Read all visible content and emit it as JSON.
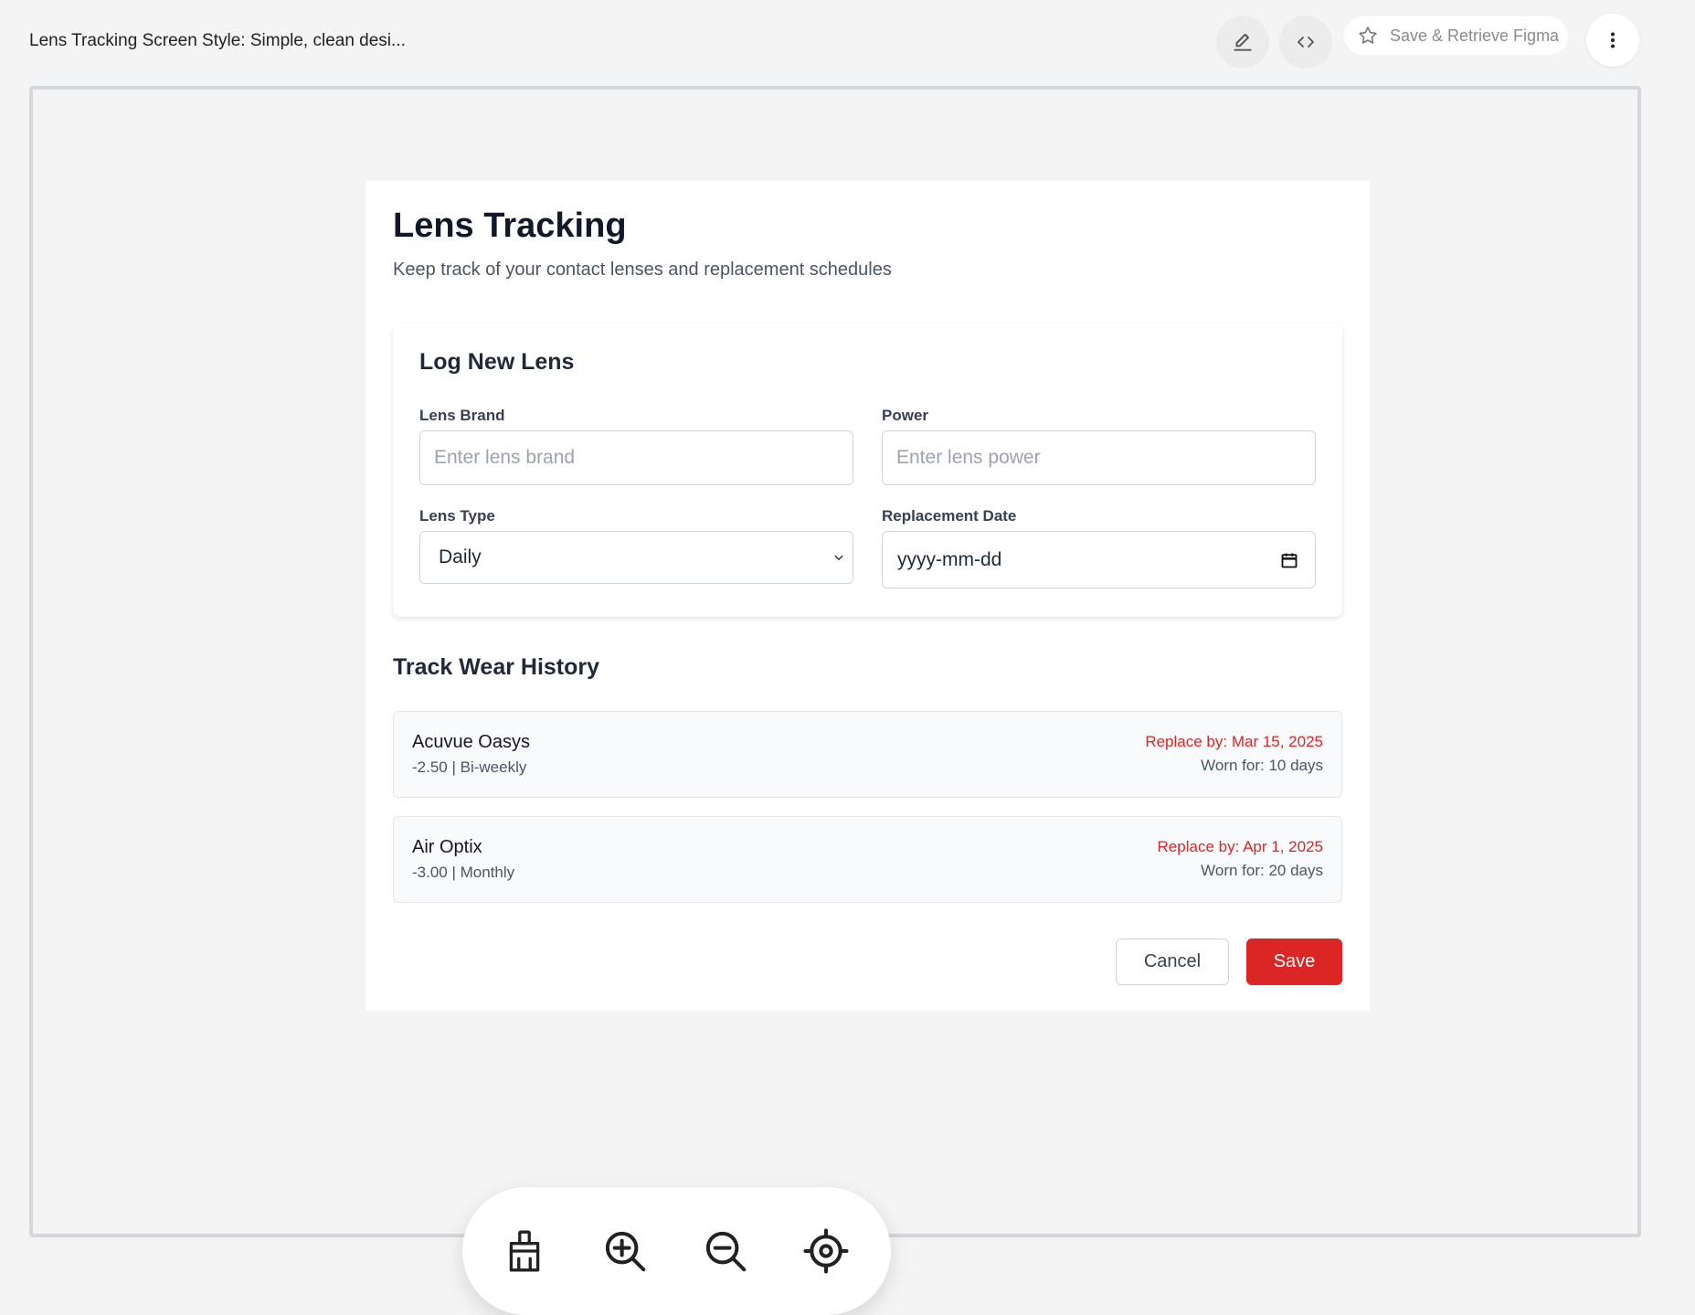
{
  "topbar": {
    "doc_title": "Lens Tracking Screen Style: Simple, clean desi...",
    "edit_icon": "pencil-icon",
    "code_icon": "code-icon",
    "save_figma_label": "Save & Retrieve Figma",
    "save_figma_icon": "star-icon",
    "more_icon": "more-vertical-icon"
  },
  "page": {
    "title": "Lens Tracking",
    "subtitle": "Keep track of your contact lenses and replacement schedules"
  },
  "form": {
    "title": "Log New Lens",
    "brand_label": "Lens Brand",
    "brand_placeholder": "Enter lens brand",
    "power_label": "Power",
    "power_placeholder": "Enter lens power",
    "type_label": "Lens Type",
    "type_value": "Daily",
    "date_label": "Replacement Date",
    "date_placeholder": "yyyy-mm-dd"
  },
  "history": {
    "title": "Track Wear History",
    "items": [
      {
        "name": "Acuvue Oasys",
        "meta": "-2.50 | Bi-weekly",
        "replace": "Replace by: Mar 15, 2025",
        "worn": "Worn for: 10 days"
      },
      {
        "name": "Air Optix",
        "meta": "-3.00 | Monthly",
        "replace": "Replace by: Apr 1, 2025",
        "worn": "Worn for: 20 days"
      }
    ]
  },
  "actions": {
    "cancel_label": "Cancel",
    "save_label": "Save"
  },
  "zoom_toolbar": {
    "icons": [
      "broom-icon",
      "zoom-in-icon",
      "zoom-out-icon",
      "target-icon"
    ]
  },
  "colors": {
    "accent": "#dc2626",
    "background": "#f4f4f4",
    "card": "#ffffff"
  }
}
